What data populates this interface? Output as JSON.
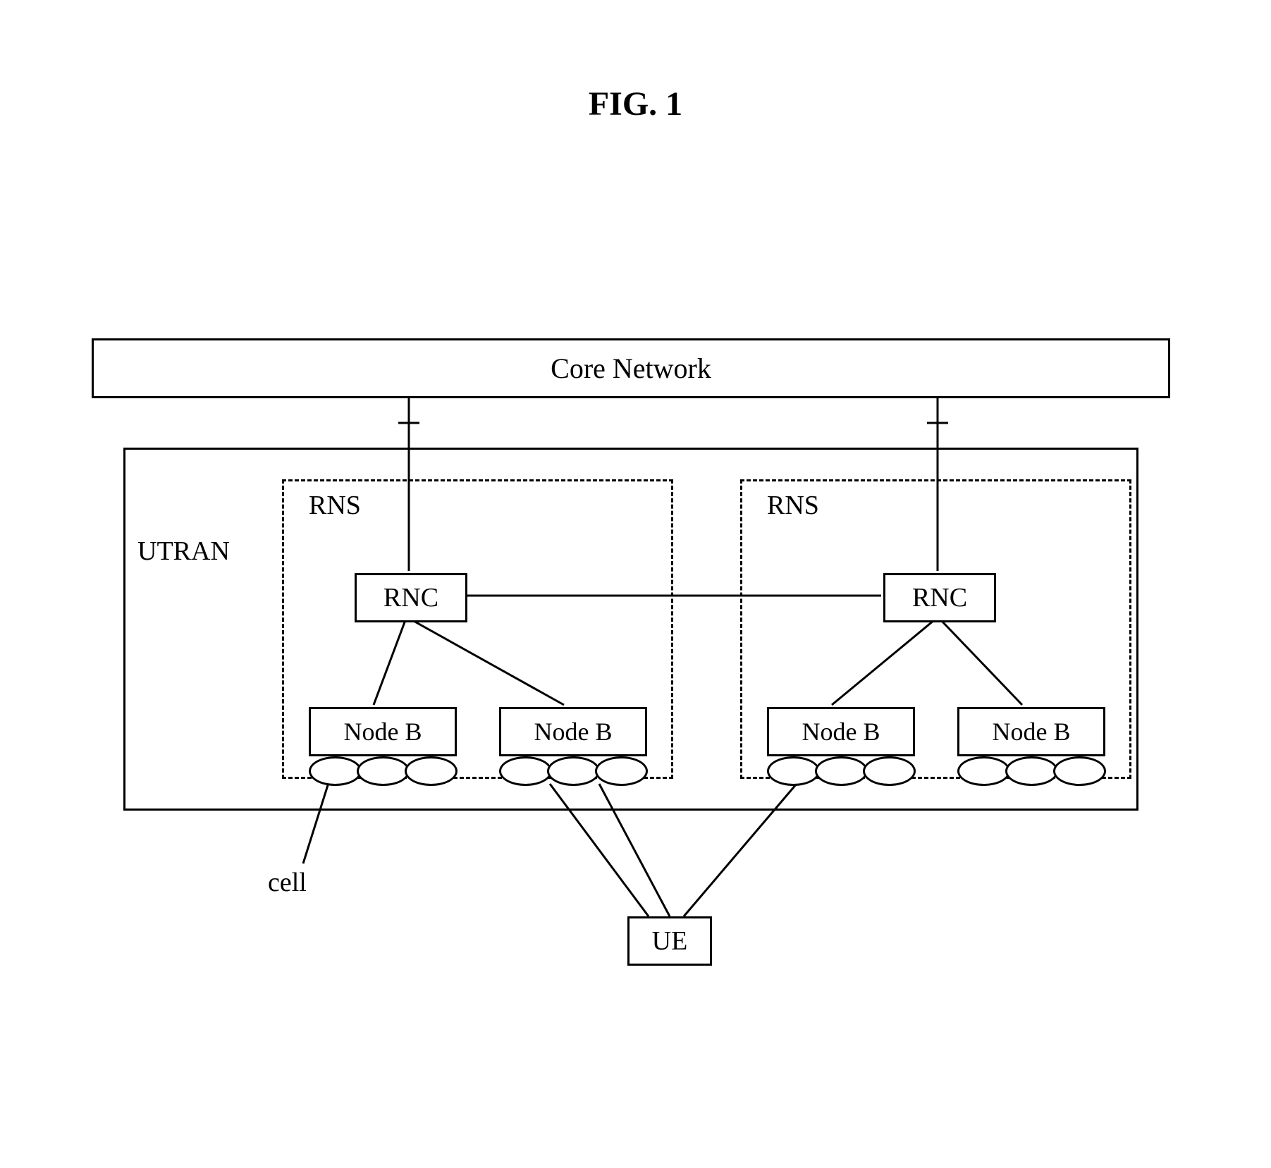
{
  "figure_title": "FIG. 1",
  "core_network": "Core Network",
  "utran_label": "UTRAN",
  "rns": {
    "left": {
      "label": "RNS",
      "rnc": "RNC",
      "nodes": [
        "Node B",
        "Node B"
      ]
    },
    "right": {
      "label": "RNS",
      "rnc": "RNC",
      "nodes": [
        "Node B",
        "Node B"
      ]
    }
  },
  "cell_label": "cell",
  "ue_label": "UE"
}
